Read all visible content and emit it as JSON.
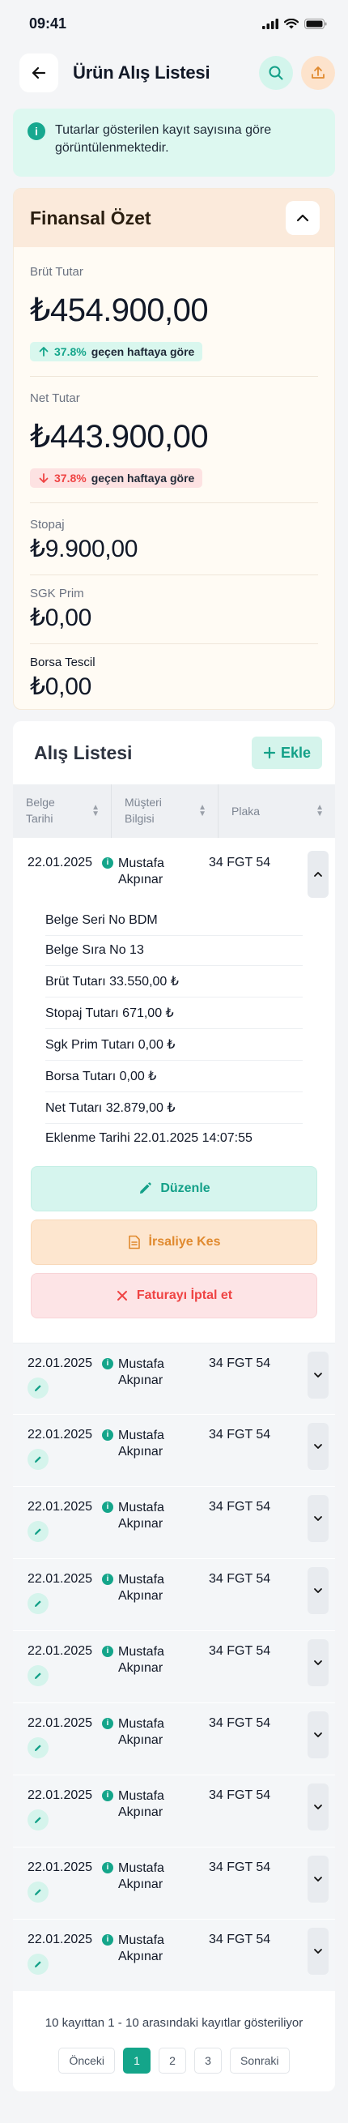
{
  "status": {
    "time": "09:41"
  },
  "header": {
    "title": "Ürün Alış Listesi"
  },
  "info": {
    "text": "Tutarlar gösterilen kayıt sayısına göre görüntülenmektedir."
  },
  "summary": {
    "title": "Finansal Özet",
    "gross": {
      "label": "Brüt Tutar",
      "value": "₺454.900,00",
      "trend_pct": "37.8%",
      "trend_text": "geçen haftaya göre"
    },
    "net": {
      "label": "Net Tutar",
      "value": "₺443.900,00",
      "trend_pct": "37.8%",
      "trend_text": "geçen haftaya göre"
    },
    "stopaj": {
      "label": "Stopaj",
      "value": "₺9.900,00"
    },
    "sgk": {
      "label": "SGK Prim",
      "value": "₺0,00"
    },
    "borsa": {
      "label": "Borsa Tescil",
      "value": "₺0,00"
    }
  },
  "list": {
    "title": "Alış Listesi",
    "add_label": "Ekle",
    "columns": {
      "date": "Belge Tarihi",
      "customer": "Müşteri Bilgisi",
      "plate": "Plaka"
    },
    "rows": [
      {
        "date": "22.01.2025",
        "customer": "Mustafa Akpınar",
        "plate": "34 FGT 54"
      },
      {
        "date": "22.01.2025",
        "customer": "Mustafa Akpınar",
        "plate": "34 FGT 54"
      },
      {
        "date": "22.01.2025",
        "customer": "Mustafa Akpınar",
        "plate": "34 FGT 54"
      },
      {
        "date": "22.01.2025",
        "customer": "Mustafa Akpınar",
        "plate": "34 FGT 54"
      },
      {
        "date": "22.01.2025",
        "customer": "Mustafa Akpınar",
        "plate": "34 FGT 54"
      },
      {
        "date": "22.01.2025",
        "customer": "Mustafa Akpınar",
        "plate": "34 FGT 54"
      },
      {
        "date": "22.01.2025",
        "customer": "Mustafa Akpınar",
        "plate": "34 FGT 54"
      },
      {
        "date": "22.01.2025",
        "customer": "Mustafa Akpınar",
        "plate": "34 FGT 54"
      },
      {
        "date": "22.01.2025",
        "customer": "Mustafa Akpınar",
        "plate": "34 FGT 54"
      },
      {
        "date": "22.01.2025",
        "customer": "Mustafa Akpınar",
        "plate": "34 FGT 54"
      }
    ],
    "details": [
      "Belge Seri No BDM",
      "Belge Sıra No 13",
      "Brüt Tutarı 33.550,00 ₺",
      "Stopaj Tutarı 671,00 ₺",
      "Sgk Prim Tutarı 0,00 ₺",
      "Borsa Tutarı 0,00 ₺",
      "Net Tutarı 32.879,00 ₺",
      "Eklenme Tarihi 22.01.2025 14:07:55"
    ],
    "actions": {
      "edit": "Düzenle",
      "waybill": "İrsaliye Kes",
      "cancel": "Faturayı İptal et"
    }
  },
  "pagination": {
    "summary": "10 kayıttan 1 - 10 arasındaki kayıtlar gösteriliyor",
    "prev": "Önceki",
    "pages": [
      "1",
      "2",
      "3"
    ],
    "next": "Sonraki"
  },
  "colors": {
    "accent": "#14a58a",
    "orange": "#e08a2f",
    "danger": "#ef4444"
  }
}
